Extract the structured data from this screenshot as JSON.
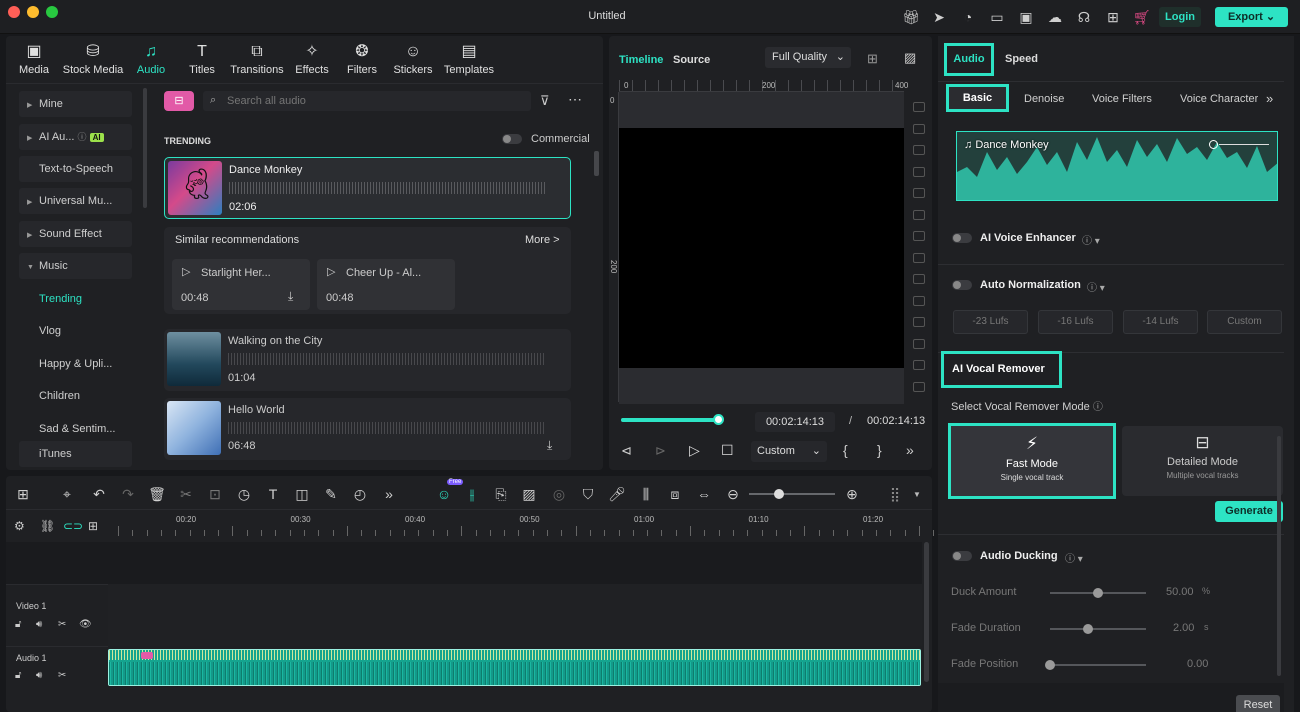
{
  "window": {
    "title": "Untitled",
    "login_label": "Login",
    "export_label": "Export"
  },
  "colors": {
    "accent": "#2de3c4",
    "close": "#ff5f57",
    "minimize": "#febc2e",
    "zoom": "#28c840"
  },
  "media_tabs": [
    "Media",
    "Stock Media",
    "Audio",
    "Titles",
    "Transitions",
    "Effects",
    "Filters",
    "Stickers",
    "Templates"
  ],
  "sidebar": {
    "items": [
      "Mine",
      "AI Au...",
      "Text-to-Speech",
      "Universal Mu...",
      "Sound Effect",
      "Music"
    ],
    "ai_badge": "AI",
    "music_children": [
      "Trending",
      "Vlog",
      "Happy & Upli...",
      "Children",
      "Sad & Sentim..."
    ],
    "bottom_item": "iTunes"
  },
  "library": {
    "search_placeholder": "Search all audio",
    "section": "TRENDING",
    "commercial_label": "Commercial",
    "selected": {
      "title": "Dance Monkey",
      "duration": "02:06"
    },
    "similar_title": "Similar recommendations",
    "more_label": "More >",
    "similar": [
      {
        "title": "Starlight Her...",
        "duration": "00:48"
      },
      {
        "title": "Cheer Up - Al...",
        "duration": "00:48"
      }
    ],
    "tracks": [
      {
        "title": "Walking on the City",
        "duration": "01:04"
      },
      {
        "title": "Hello World",
        "duration": "06:48"
      }
    ]
  },
  "preview": {
    "tab_timeline": "Timeline",
    "tab_source": "Source",
    "quality": "Full Quality",
    "ruler": [
      "0",
      "200",
      "400"
    ],
    "vruler": [
      "0",
      "200"
    ],
    "current_time": "00:02:14:13",
    "separator": "/",
    "total_time": "00:02:14:13",
    "progress": 1.0,
    "zoom_mode": "Custom"
  },
  "timeline": {
    "ruler": [
      "00:20",
      "00:30",
      "00:40",
      "00:50",
      "01:00",
      "01:10",
      "01:20"
    ],
    "tracks": [
      {
        "name": "Video 1"
      },
      {
        "name": "Audio 1"
      }
    ],
    "free_badge": "Free",
    "zoom_level": 0.35
  },
  "right_panel": {
    "tabs": [
      "Audio",
      "Speed"
    ],
    "subtabs": [
      "Basic",
      "Denoise",
      "Voice Filters",
      "Voice Character"
    ],
    "clip_name": "Dance Monkey",
    "ai_voice_enhancer": "AI Voice Enhancer",
    "auto_normalization": "Auto Normalization",
    "lufs": [
      "-23 Lufs",
      "-16 Lufs",
      "-14 Lufs",
      "Custom"
    ],
    "vocal_remover_title": "AI Vocal Remover",
    "mode_label": "Select Vocal Remover Mode",
    "modes": [
      {
        "title": "Fast Mode",
        "sub": "Single vocal track"
      },
      {
        "title": "Detailed Mode",
        "sub": "Multiple vocal tracks"
      }
    ],
    "generate_label": "Generate",
    "audio_ducking": "Audio Ducking",
    "ducking_rows": [
      {
        "label": "Duck Amount",
        "value": "50.00",
        "unit": "%",
        "level": 0.5
      },
      {
        "label": "Fade Duration",
        "value": "2.00",
        "unit": "s",
        "level": 0.4
      },
      {
        "label": "Fade Position",
        "value": "0.00",
        "unit": "",
        "level": 0.0
      }
    ],
    "reset_label": "Reset"
  }
}
